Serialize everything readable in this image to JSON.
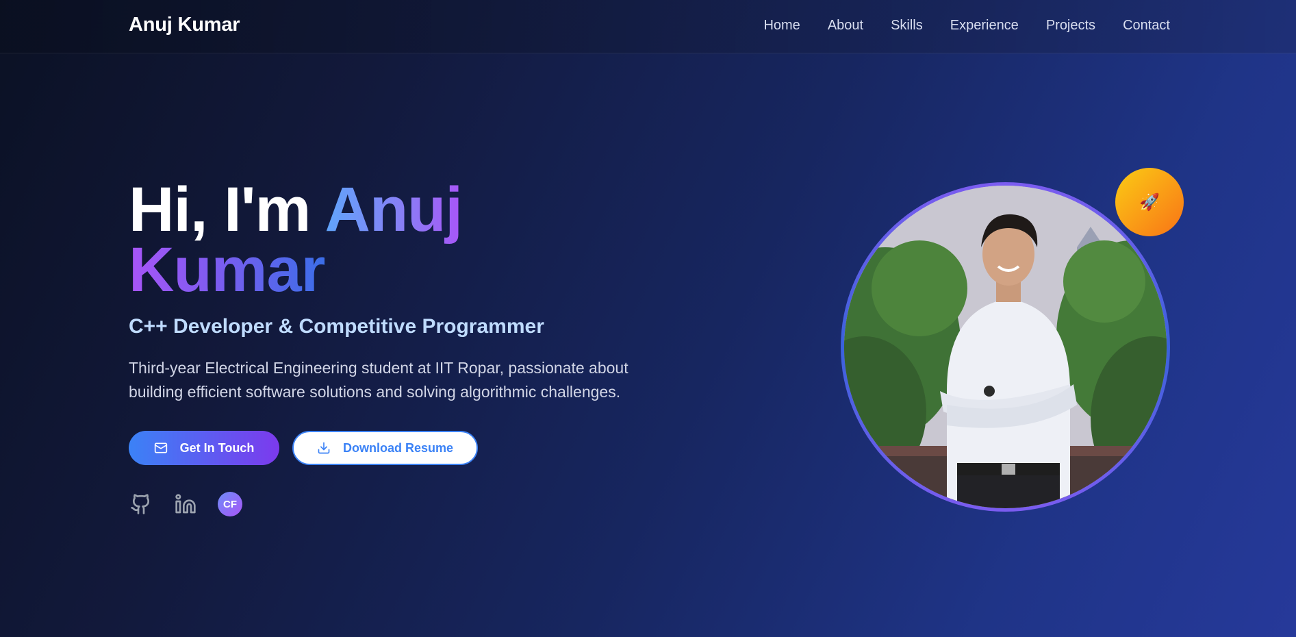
{
  "nav": {
    "brand": "Anuj Kumar",
    "links": [
      "Home",
      "About",
      "Skills",
      "Experience",
      "Projects",
      "Contact"
    ]
  },
  "hero": {
    "greeting": "Hi, I'm ",
    "first_name": "Anuj",
    "last_name": "Kumar",
    "subtitle": "C++ Developer & Competitive Programmer",
    "description": "Third-year Electrical Engineering student at IIT Ropar, passionate about building efficient software solutions and solving algorithmic challenges.",
    "primary_button": "Get In Touch",
    "secondary_button": "Download Resume",
    "codeforces_badge": "CF",
    "rocket_emoji": "🚀"
  },
  "icons": {
    "email": "mail-icon",
    "download": "download-icon",
    "github": "github-icon",
    "linkedin": "linkedin-icon"
  },
  "colors": {
    "accent_blue": "#3b82f6",
    "accent_purple": "#7c3aed",
    "subtitle": "#bfdbfe",
    "badge_yellow": "#facc15",
    "badge_orange": "#f97316"
  }
}
